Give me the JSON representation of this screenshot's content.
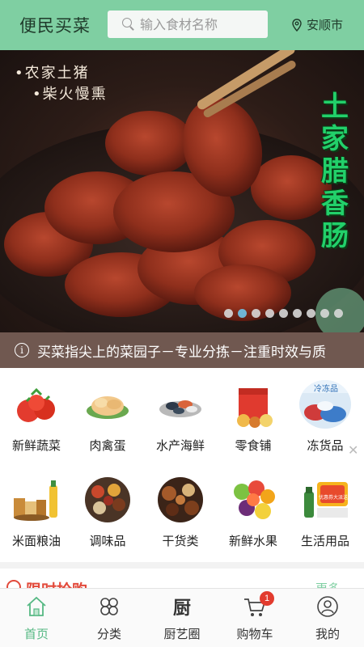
{
  "header": {
    "app_title": "便民买菜",
    "search_placeholder": "输入食材名称",
    "location": "安顺市",
    "background_color": "#7fcfa2"
  },
  "banner": {
    "tag_lines": [
      "•农家土猪",
      "•柴火慢熏"
    ],
    "vertical_title": [
      "土",
      "家",
      "腊",
      "香",
      "肠"
    ],
    "slide_count": 9,
    "active_slide": 2
  },
  "notice": {
    "icon": "info-icon",
    "text": "买菜指尖上的菜园子－专业分拣－注重时效与质"
  },
  "categories": [
    {
      "label": "新鲜蔬菜",
      "icon": "tomato-icon"
    },
    {
      "label": "肉禽蛋",
      "icon": "chicken-icon"
    },
    {
      "label": "水产海鲜",
      "icon": "seafood-icon"
    },
    {
      "label": "零食铺",
      "icon": "snack-bag-icon"
    },
    {
      "label": "冻货品",
      "icon": "frozen-food-icon"
    },
    {
      "label": "米面粮油",
      "icon": "grain-oil-icon"
    },
    {
      "label": "调味品",
      "icon": "spice-icon"
    },
    {
      "label": "干货类",
      "icon": "dried-goods-icon"
    },
    {
      "label": "新鲜水果",
      "icon": "fruit-icon"
    },
    {
      "label": "生活用品",
      "icon": "household-icon"
    }
  ],
  "frozen_label_text": "冷冻品",
  "promo_text": "优惠券大派送",
  "flash_sale": {
    "title": "限时抢购",
    "more": "更多"
  },
  "tabbar": {
    "tabs": [
      {
        "label": "首页",
        "icon": "home-icon",
        "active": true
      },
      {
        "label": "分类",
        "icon": "category-icon",
        "active": false
      },
      {
        "label": "厨艺圈",
        "icon": "kitchen-icon",
        "active": false
      },
      {
        "label": "购物车",
        "icon": "cart-icon",
        "active": false
      },
      {
        "label": "我的",
        "icon": "user-icon",
        "active": false
      }
    ],
    "cart_badge": "1",
    "kitchen_glyph": "厨",
    "active_color": "#55b883",
    "badge_color": "#e23b2e"
  }
}
